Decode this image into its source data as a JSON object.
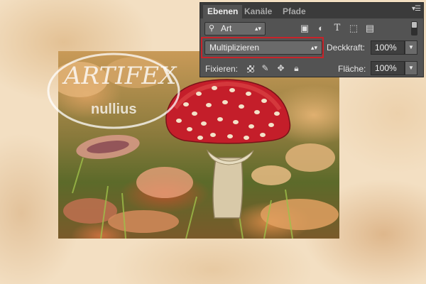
{
  "panel": {
    "tabs": [
      {
        "label": "Ebenen",
        "active": true
      },
      {
        "label": "Kanäle",
        "active": false
      },
      {
        "label": "Pfade",
        "active": false
      }
    ],
    "menu_icon": "panel-menu-icon",
    "filter": {
      "value": "Art",
      "icon": "search-icon"
    },
    "filter_icons": [
      "image-filter-icon",
      "adjustment-filter-icon",
      "type-filter-icon",
      "shape-filter-icon",
      "smart-object-filter-icon"
    ],
    "blend_mode": "Multiplizieren",
    "opacity_label": "Deckkraft:",
    "opacity_value": "100%",
    "lock_label": "Fixieren:",
    "fill_label": "Fläche:",
    "fill_value": "100%",
    "lock_icons": [
      "lock-transparent-pixels-icon",
      "lock-image-pixels-icon",
      "lock-position-icon",
      "lock-all-icon"
    ],
    "highlight_color": "#c8232a"
  },
  "canvas": {
    "watermark": "ARTIFEX Nullius",
    "subject": "fly-agaric-mushroom"
  }
}
